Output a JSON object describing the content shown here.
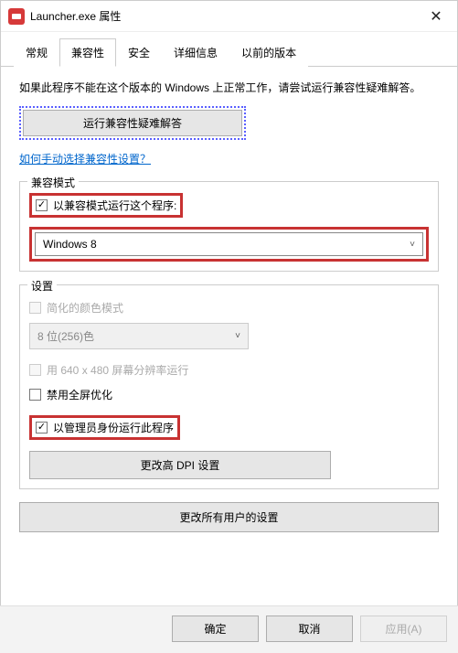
{
  "titlebar": {
    "title": "Launcher.exe 属性"
  },
  "tabs": {
    "general": "常规",
    "compat": "兼容性",
    "security": "安全",
    "details": "详细信息",
    "previous": "以前的版本"
  },
  "intro": "如果此程序不能在这个版本的 Windows 上正常工作，请尝试运行兼容性疑难解答。",
  "troubleshoot_btn": "运行兼容性疑难解答",
  "manual_link": "如何手动选择兼容性设置？",
  "compat_mode": {
    "legend": "兼容模式",
    "checkbox_label": "以兼容模式运行这个程序:",
    "selected": "Windows 8"
  },
  "settings": {
    "legend": "设置",
    "reduced_color": "简化的颜色模式",
    "color_depth": "8 位(256)色",
    "res_640": "用 640 x 480 屏幕分辨率运行",
    "disable_fullscreen_opt": "禁用全屏优化",
    "run_as_admin": "以管理员身份运行此程序",
    "dpi_btn": "更改高 DPI 设置"
  },
  "all_users_btn": "更改所有用户的设置",
  "footer": {
    "ok": "确定",
    "cancel": "取消",
    "apply": "应用(A)"
  }
}
